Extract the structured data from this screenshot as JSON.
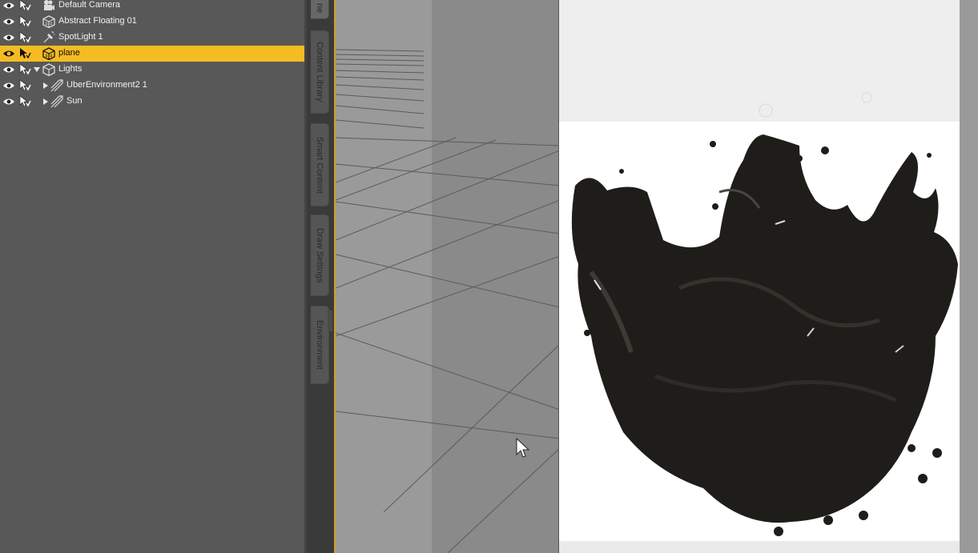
{
  "scene_items": [
    {
      "label": "Default Camera",
      "icon": "camera-icon",
      "selected": false,
      "expander": "none"
    },
    {
      "label": "Abstract Floating 01",
      "icon": "figure-cube-icon",
      "selected": false,
      "expander": "none"
    },
    {
      "label": "SpotLight 1",
      "icon": "spotlight-icon",
      "selected": false,
      "expander": "none"
    },
    {
      "label": "plane",
      "icon": "primitive-cube-icon",
      "selected": true,
      "expander": "none"
    },
    {
      "label": "Lights",
      "icon": "group-icon",
      "selected": false,
      "expander": "expanded"
    },
    {
      "label": "UberEnvironment2 1",
      "icon": "light-icon",
      "selected": false,
      "expander": "collapsed"
    },
    {
      "label": "Sun",
      "icon": "light-icon",
      "selected": false,
      "expander": "collapsed"
    }
  ],
  "side_tabs": [
    "ne",
    "Content Library",
    "Smart Content",
    "Draw Settings",
    "Environment"
  ],
  "colors": {
    "selection": "#f5bc22",
    "panel": "#585858",
    "viewport": "#8f8f8f",
    "render_bg": "#ffffff",
    "splash": "#1f1d1a"
  }
}
